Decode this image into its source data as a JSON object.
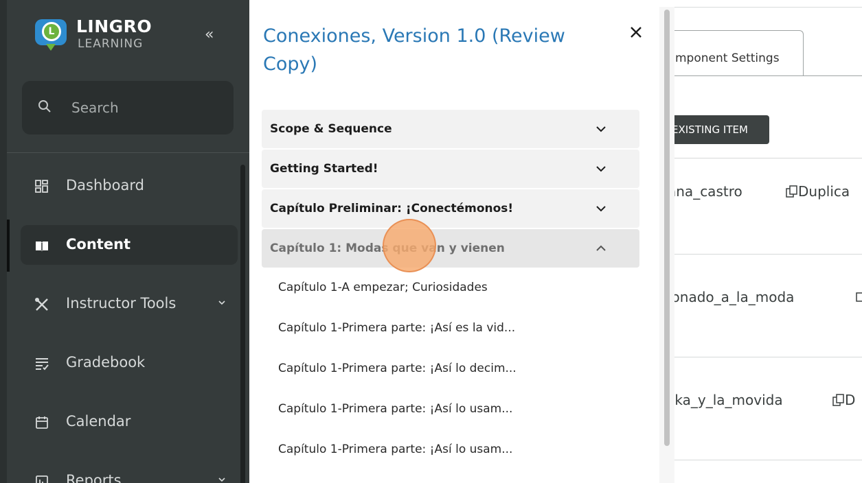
{
  "sidebar": {
    "logo": {
      "line1": "LINGRO",
      "line2": "LEARNING",
      "badge": "L"
    },
    "collapse_label": "«",
    "search": {
      "placeholder": "Search"
    },
    "items": [
      {
        "label": "Dashboard",
        "icon": "dashboard-icon"
      },
      {
        "label": "Content",
        "icon": "book-icon",
        "active": true
      },
      {
        "label": "Instructor Tools",
        "icon": "tools-icon",
        "has_submenu": true
      },
      {
        "label": "Gradebook",
        "icon": "gradebook-icon"
      },
      {
        "label": "Calendar",
        "icon": "calendar-icon"
      },
      {
        "label": "Reports",
        "icon": "reports-icon",
        "has_submenu": true
      }
    ]
  },
  "panel": {
    "title": "Conexiones, Version 1.0 (Review Copy)",
    "close_label": "×",
    "sections": [
      {
        "title": "Scope & Sequence",
        "expanded": false
      },
      {
        "title": "Getting Started!",
        "expanded": false
      },
      {
        "title": "Capítulo Preliminar: ¡Conectémonos!",
        "expanded": false
      },
      {
        "title": "Capítulo 1: Modas que van y vienen",
        "expanded": true
      }
    ],
    "subitems": [
      "Capítulo 1-A empezar; Curiosidades",
      "Capítulo 1-Primera parte: ¡Así es la vid...",
      "Capítulo 1-Primera parte: ¡Así lo decim...",
      "Capítulo 1-Primera parte: ¡Así lo usam...",
      "Capítulo 1-Primera parte: ¡Así lo usam..."
    ]
  },
  "background": {
    "tab_label": "mponent Settings",
    "existing_button": "EXISTING ITEM",
    "rows": [
      {
        "text": "ana_castro",
        "action": "Duplica"
      },
      {
        "text": "ionado_a_la_moda",
        "action": ""
      },
      {
        "text": "ska_y_la_movida",
        "action": "D"
      }
    ]
  },
  "colors": {
    "sidebar_bg": "#353b3b",
    "title_blue": "#2a78b5",
    "cursor_highlight": "#f6aa6e"
  }
}
